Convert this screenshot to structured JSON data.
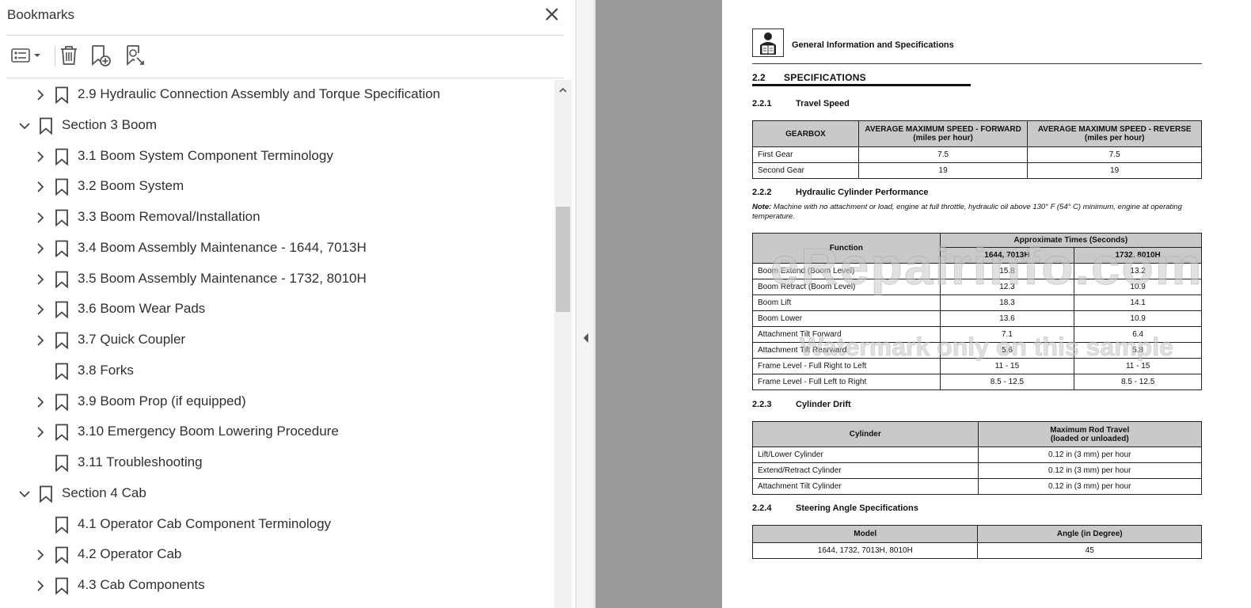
{
  "bookmarks_panel": {
    "title": "Bookmarks",
    "close_icon": "close-icon",
    "toolbar": {
      "options_icon": "options-list-icon",
      "delete_icon": "trash-icon",
      "new_bookmark_icon": "new-bookmark-icon",
      "find_bookmark_icon": "find-bookmark-icon"
    },
    "items": [
      {
        "label": "2.9 Hydraulic Connection Assembly and Torque Specification",
        "level": 1,
        "expander": "collapsed"
      },
      {
        "label": "Section 3 Boom",
        "level": 0,
        "expander": "expanded"
      },
      {
        "label": "3.1 Boom System Component Terminology",
        "level": 1,
        "expander": "collapsed"
      },
      {
        "label": "3.2 Boom System",
        "level": 1,
        "expander": "collapsed"
      },
      {
        "label": "3.3 Boom Removal/Installation",
        "level": 1,
        "expander": "collapsed"
      },
      {
        "label": "3.4 Boom Assembly Maintenance - 1644, 7013H",
        "level": 1,
        "expander": "collapsed"
      },
      {
        "label": "3.5 Boom Assembly Maintenance - 1732, 8010H",
        "level": 1,
        "expander": "collapsed"
      },
      {
        "label": "3.6 Boom Wear Pads",
        "level": 1,
        "expander": "collapsed"
      },
      {
        "label": "3.7 Quick Coupler",
        "level": 1,
        "expander": "collapsed"
      },
      {
        "label": "3.8 Forks",
        "level": 1,
        "expander": "none"
      },
      {
        "label": "3.9 Boom Prop (if equipped)",
        "level": 1,
        "expander": "collapsed"
      },
      {
        "label": "3.10 Emergency Boom Lowering Procedure",
        "level": 1,
        "expander": "collapsed"
      },
      {
        "label": "3.11 Troubleshooting",
        "level": 1,
        "expander": "none"
      },
      {
        "label": "Section 4 Cab",
        "level": 0,
        "expander": "expanded"
      },
      {
        "label": "4.1 Operator Cab Component Terminology",
        "level": 1,
        "expander": "none"
      },
      {
        "label": "4.2 Operator Cab",
        "level": 1,
        "expander": "collapsed"
      },
      {
        "label": "4.3 Cab Components",
        "level": 1,
        "expander": "collapsed"
      }
    ],
    "scrollbar": {
      "thumb_position_fraction": 0.24
    }
  },
  "colors": {
    "doc_background": "#9a9a9a",
    "table_header": "#c9c9c9",
    "panel_text": "#303030"
  },
  "page": {
    "header_icon": "manual-reader-icon",
    "header_title": "General Information and Specifications",
    "section": {
      "number": "2.2",
      "title": "SPECIFICATIONS"
    },
    "travel_speed": {
      "number": "2.2.1",
      "title": "Travel Speed",
      "headers": [
        "GEARBOX",
        "AVERAGE MAXIMUM SPEED - FORWARD",
        "AVERAGE MAXIMUM SPEED - REVERSE"
      ],
      "header_sub": [
        "(miles per hour)",
        "(miles per hour)"
      ],
      "rows": [
        [
          "First Gear",
          "7.5",
          "7.5"
        ],
        [
          "Second Gear",
          "19",
          "19"
        ]
      ]
    },
    "cylinder_performance": {
      "number": "2.2.2",
      "title": "Hydraulic Cylinder Performance",
      "note_label": "Note:",
      "note_text": "Machine with no attachment or load, engine at full throttle, hydraulic oil above 130° F (54° C) minimum, engine at operating temperature.",
      "header_function": "Function",
      "header_times": "Approximate Times (Seconds)",
      "header_models": [
        "1644, 7013H",
        "1732, 8010H"
      ],
      "rows": [
        [
          "Boom Extend (Boom Level)",
          "15.8",
          "13.2"
        ],
        [
          "Boom Retract (Boom Level)",
          "12.3",
          "10.9"
        ],
        [
          "Boom Lift",
          "18.3",
          "14.1"
        ],
        [
          "Boom Lower",
          "13.6",
          "10.9"
        ],
        [
          "Attachment Tilt Forward",
          "7.1",
          "6.4"
        ],
        [
          "Attachment Tilt Rearward",
          "5.6",
          "5.8"
        ],
        [
          "Frame Level - Full Right to Left",
          "11 - 15",
          "11 - 15"
        ],
        [
          "Frame Level - Full Left to Right",
          "8.5 - 12.5",
          "8.5 - 12.5"
        ]
      ]
    },
    "cylinder_drift": {
      "number": "2.2.3",
      "title": "Cylinder Drift",
      "header_cylinder": "Cylinder",
      "header_travel": "Maximum Rod Travel",
      "header_travel_sub": "(loaded or unloaded)",
      "rows": [
        [
          "Lift/Lower Cylinder",
          "0.12 in (3 mm) per hour"
        ],
        [
          "Extend/Retract Cylinder",
          "0.12 in (3 mm) per hour"
        ],
        [
          "Attachment Tilt Cylinder",
          "0.12 in (3 mm) per hour"
        ]
      ]
    },
    "steering": {
      "number": "2.2.4",
      "title": "Steering Angle Specifications",
      "headers": [
        "Model",
        "Angle (in Degree)"
      ],
      "rows": [
        [
          "1644, 1732, 7013H, 8010H",
          "45"
        ]
      ]
    },
    "watermark_main": "eRepairinfo.com",
    "watermark_sub": "Watermark only on this sample"
  }
}
